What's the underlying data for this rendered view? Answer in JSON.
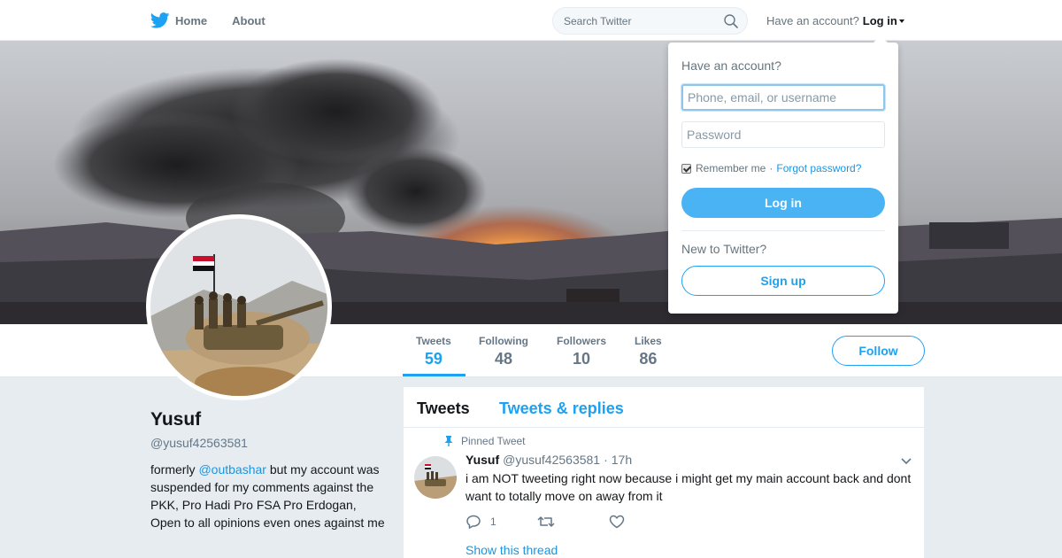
{
  "nav": {
    "home_label": "Home",
    "about_label": "About",
    "search_placeholder": "Search Twitter",
    "have_account": "Have an account?",
    "login_label": "Log in",
    "brand_color": "#1da1f2"
  },
  "login_dropdown": {
    "title": "Have an account?",
    "username_placeholder": "Phone, email, or username",
    "password_placeholder": "Password",
    "remember_label": "Remember me",
    "separator": "·",
    "forgot_label": "Forgot password?",
    "login_button": "Log in",
    "new_prompt": "New to Twitter?",
    "signup_button": "Sign up"
  },
  "stats": [
    {
      "label": "Tweets",
      "value": "59",
      "active": true
    },
    {
      "label": "Following",
      "value": "48"
    },
    {
      "label": "Followers",
      "value": "10"
    },
    {
      "label": "Likes",
      "value": "86"
    }
  ],
  "follow_button": "Follow",
  "profile": {
    "name": "Yusuf",
    "handle": "@yusuf42563581",
    "bio_prefix": "formerly",
    "bio_mention": "@outbashar",
    "bio_suffix": "but my account was suspended for my comments against the PKK, Pro Hadi Pro FSA Pro Erdogan, Open to all opinions even ones against me"
  },
  "timeline": {
    "tab_tweets": "Tweets",
    "tab_replies": "Tweets & replies",
    "tweet": {
      "pinned_label": "Pinned Tweet",
      "name": "Yusuf",
      "handle": "@yusuf42563581",
      "separator": "·",
      "time": "17h",
      "text": "i am NOT tweeting right now because i might get my main account back and dont want to totally move on away from it",
      "reply_count": "1",
      "show_thread": "Show this thread"
    }
  }
}
